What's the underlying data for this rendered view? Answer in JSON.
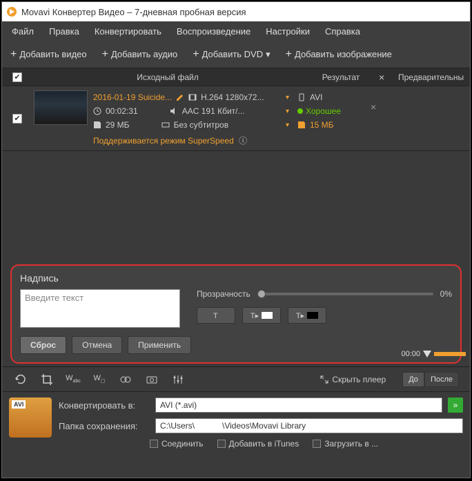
{
  "title": "Movavi Конвертер Видео – 7-дневная пробная версия",
  "menu": [
    "Файл",
    "Правка",
    "Конвертировать",
    "Воспроизведение",
    "Настройки",
    "Справка"
  ],
  "toolbar": {
    "add_video": "Добавить видео",
    "add_audio": "Добавить аудио",
    "add_dvd": "Добавить DVD",
    "add_image": "Добавить изображение"
  },
  "headers": {
    "source": "Исходный файл",
    "result": "Результат",
    "preview": "Предварительны"
  },
  "file": {
    "name": "2016-01-19 Suicide...",
    "video_codec": "H.264 1280x72...",
    "duration": "00:02:31",
    "audio_codec": "AAC 191 Кбит/...",
    "size": "29 МБ",
    "subs": "Без субтитров",
    "speed_note": "Поддерживается режим SuperSpeed"
  },
  "result": {
    "format": "AVI",
    "quality": "Хорошее",
    "size": "15 МБ"
  },
  "caption": {
    "title": "Надпись",
    "placeholder": "Введите текст",
    "opacity_label": "Прозрачность",
    "opacity_value": "0%",
    "reset": "Сброс",
    "cancel": "Отмена",
    "apply": "Применить"
  },
  "player": {
    "hide": "Скрыть плеер",
    "before": "До",
    "after": "После",
    "time": "00:00"
  },
  "output": {
    "convert_to_label": "Конвертировать в:",
    "convert_to_value": "AVI (*.avi)",
    "folder_label": "Папка сохранения:",
    "folder_value": "C:\\Users\\            \\Videos\\Movavi Library",
    "format_badge": "AVI",
    "join": "Соединить",
    "itunes": "Добавить в iTunes",
    "upload": "Загрузить в ..."
  }
}
